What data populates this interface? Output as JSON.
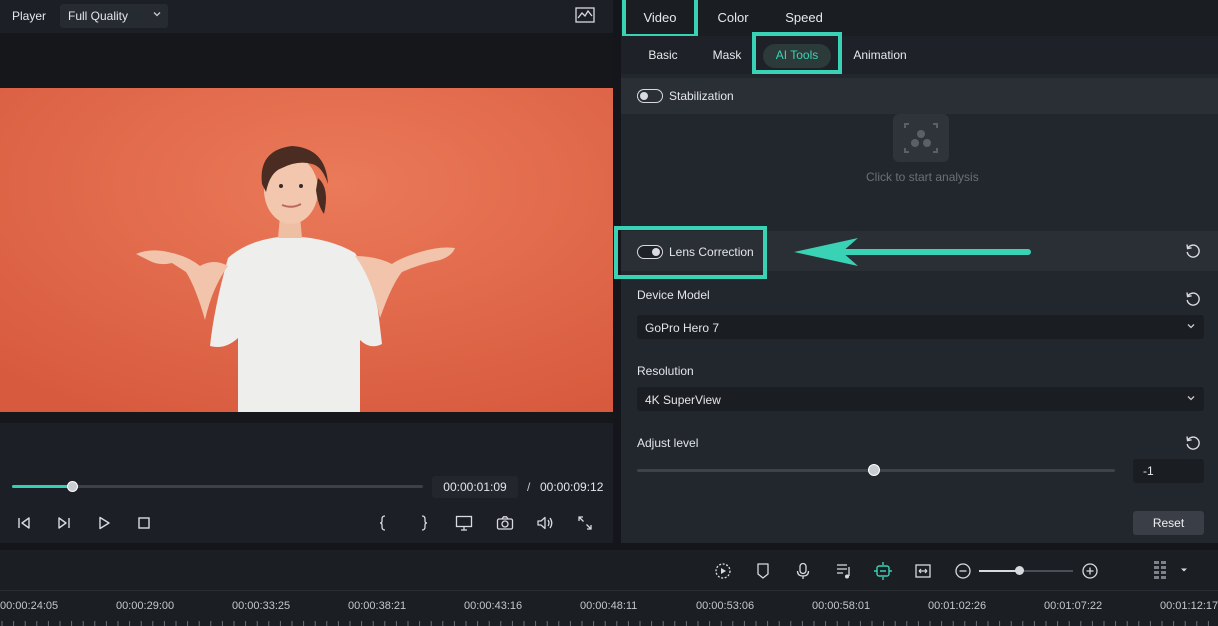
{
  "player": {
    "label": "Player",
    "quality": "Full Quality",
    "current_time": "00:00:01:09",
    "separator": "/",
    "total_time": "00:00:09:12",
    "progress": 0.15
  },
  "tabs": {
    "video": "Video",
    "color": "Color",
    "speed": "Speed",
    "active": "Video"
  },
  "subtabs": {
    "basic": "Basic",
    "mask": "Mask",
    "ai_tools": "AI Tools",
    "animation": "Animation",
    "active": "AI Tools"
  },
  "stabilization": {
    "label": "Stabilization",
    "enabled": false,
    "analysis_hint": "Click to start analysis"
  },
  "lens_correction": {
    "label": "Lens Correction",
    "enabled": true,
    "device_model_label": "Device Model",
    "device_model_value": "GoPro Hero 7",
    "resolution_label": "Resolution",
    "resolution_value": "4K SuperView",
    "adjust_level_label": "Adjust level",
    "adjust_level_value": "-1",
    "adjust_level_slider": 0.49,
    "reset_label": "Reset"
  },
  "timeline": {
    "ticks": [
      "00:00:24:05",
      "00:00:29:00",
      "00:00:33:25",
      "00:00:38:21",
      "00:00:43:16",
      "00:00:48:11",
      "00:00:53:06",
      "00:00:58:01",
      "00:01:02:26",
      "00:01:07:22",
      "00:01:12:17"
    ],
    "zoom_level": 0.4
  },
  "colors": {
    "accent": "#3ad2b5",
    "video_background": "#e2684a"
  }
}
